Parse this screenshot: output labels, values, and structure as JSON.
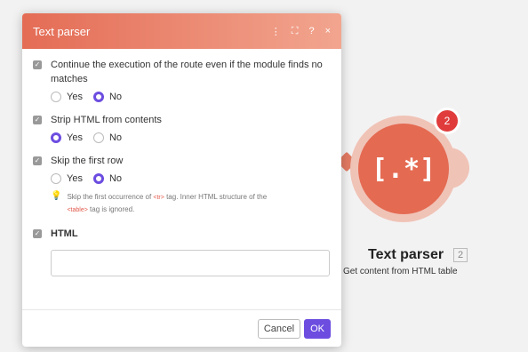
{
  "dialog": {
    "title": "Text parser",
    "header_icons": [
      "⋮",
      "⛶",
      "?",
      "×"
    ],
    "continue_label": "Continue the execution of the route even if the module finds no matches",
    "continue_yes": "Yes",
    "continue_no": "No",
    "strip_label": "Strip HTML from contents",
    "strip_yes": "Yes",
    "strip_no": "No",
    "skip_label": "Skip the first row",
    "skip_yes": "Yes",
    "skip_no": "No",
    "hint": {
      "part1": "Skip the first occurrence of ",
      "tr_tag": "<tr>",
      "part2": " tag. Inner HTML structure of the",
      "table_tag": "<table>",
      "part3": " tag is ignored."
    },
    "html_label": "HTML",
    "html_value": "",
    "cancel_label": "Cancel",
    "ok_label": "OK"
  },
  "module": {
    "glyph": "[.*]",
    "badge": "2",
    "title": "Text parser",
    "id": "2",
    "subtitle": "Get content from HTML table"
  },
  "colors": {
    "accent": "#e46a52",
    "primary_button": "#6c4de0",
    "badge": "#e03c3c"
  }
}
